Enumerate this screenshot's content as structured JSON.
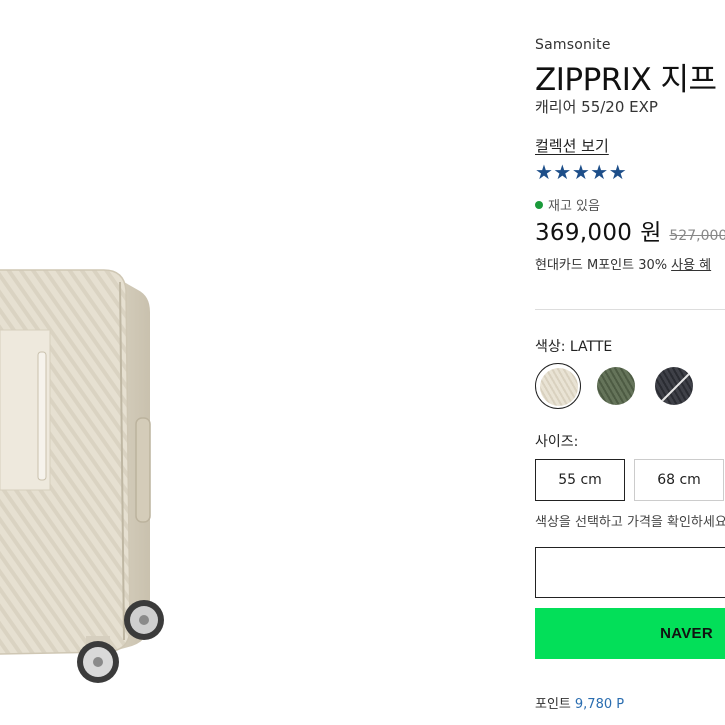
{
  "product": {
    "brand": "Samsonite",
    "title": "ZIPPRIX 지프",
    "subtitle": "캐리어 55/20 EXP",
    "collection_link": "컬렉션 보기",
    "rating_stars": "★★★★★",
    "rating_value": 5,
    "stock_status": "재고 있음",
    "price": "369,000",
    "price_unit": "원",
    "original_price": "527,000",
    "card_benefit": "현대카드 M포인트 30%",
    "card_benefit_link": "사용 혜",
    "points_label": "포인트",
    "points_value": "9,780 P"
  },
  "options": {
    "color_label": "색상: LATTE",
    "colors": [
      {
        "name": "LATTE",
        "hex": "#e3dccb",
        "selected": true
      },
      {
        "name": "olive",
        "hex": "#5a6a4e",
        "selected": false
      },
      {
        "name": "charcoal",
        "hex": "#35373d",
        "selected": false
      }
    ],
    "size_label": "사이즈:",
    "sizes": [
      {
        "label": "55 cm",
        "selected": true
      },
      {
        "label": "68 cm",
        "selected": false
      }
    ],
    "note": "색상을 선택하고 가격을 확인하세요"
  },
  "actions": {
    "naver_pay_label": "NAVER"
  },
  "colors": {
    "star": "#1d4e89",
    "stock_dot": "#1a9a3a",
    "naver_green": "#03df59",
    "points_value": "#2a6db0",
    "luggage_shell": "#e3dccb"
  }
}
